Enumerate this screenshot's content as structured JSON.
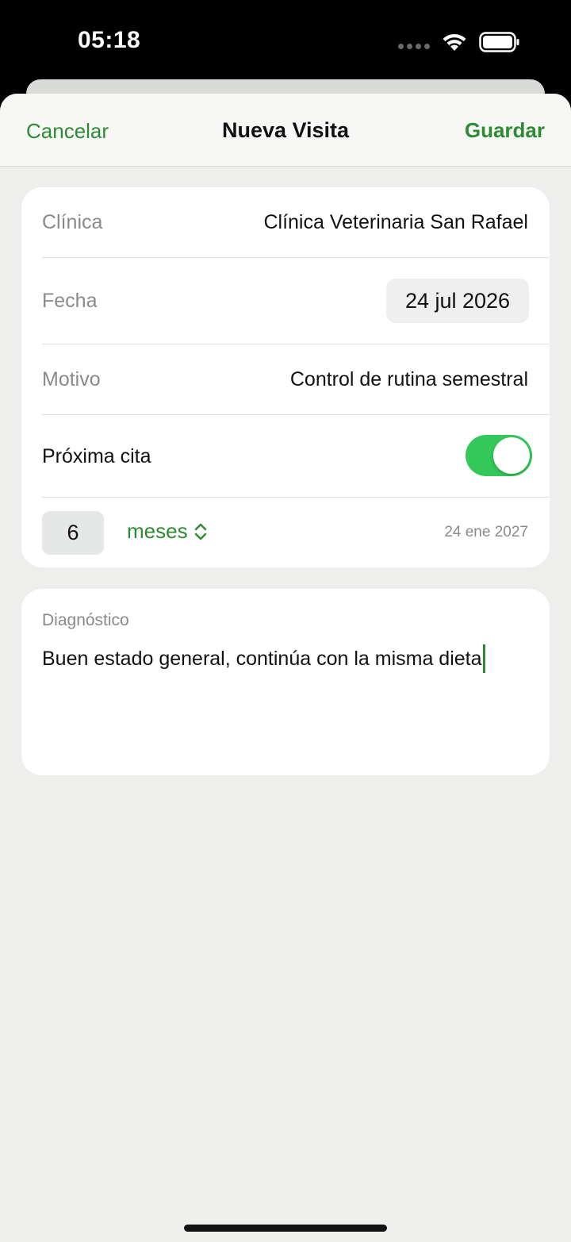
{
  "status": {
    "time": "05:18"
  },
  "nav": {
    "cancel": "Cancelar",
    "title": "Nueva Visita",
    "save": "Guardar"
  },
  "form": {
    "clinic_label": "Clínica",
    "clinic_value": "Clínica Veterinaria San Rafael",
    "date_label": "Fecha",
    "date_value": "24 jul 2026",
    "reason_label": "Motivo",
    "reason_value": "Control de rutina semestral",
    "next_label": "Próxima cita",
    "next_enabled": true,
    "interval_value": "6",
    "interval_unit": "meses",
    "next_date": "24 ene 2027"
  },
  "notes": {
    "label": "Diagnóstico",
    "text": "Buen estado general, continúa con la misma dieta"
  },
  "colors": {
    "accent": "#2f8a34",
    "toggle_on": "#34c759",
    "background": "#eeefec"
  }
}
